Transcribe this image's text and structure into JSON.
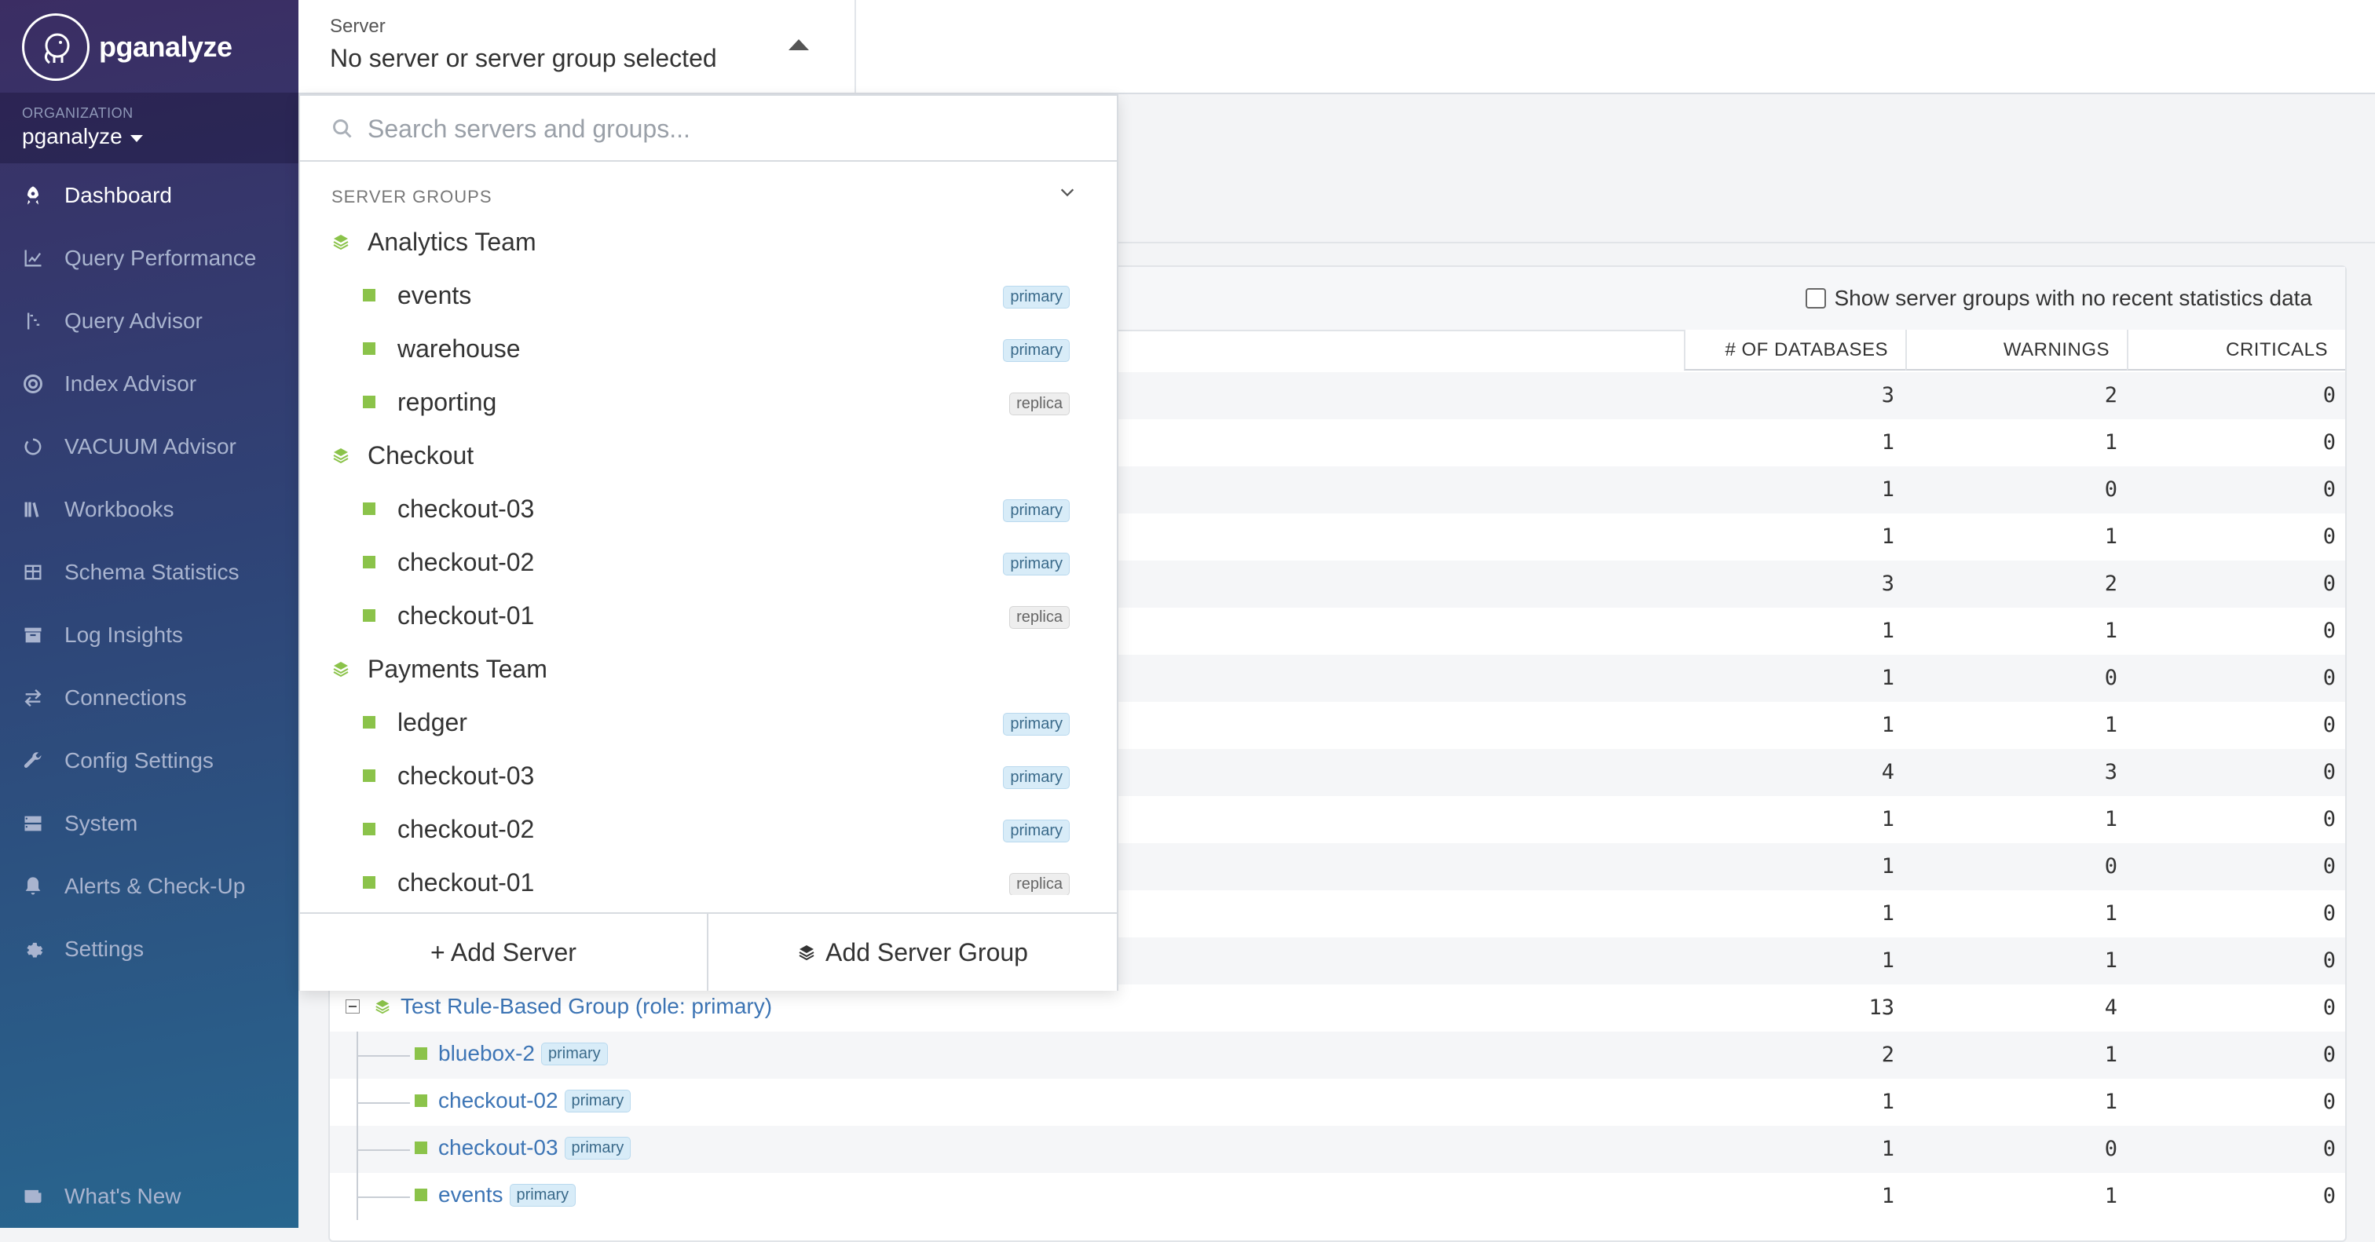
{
  "app": {
    "name": "pganalyze"
  },
  "organization": {
    "label": "ORGANIZATION",
    "value": "pganalyze"
  },
  "nav": [
    {
      "label": "Dashboard",
      "icon": "rocket-icon",
      "active": true
    },
    {
      "label": "Query Performance",
      "icon": "line-chart-icon"
    },
    {
      "label": "Query Advisor",
      "icon": "advisor-icon"
    },
    {
      "label": "Index Advisor",
      "icon": "target-icon"
    },
    {
      "label": "VACUUM Advisor",
      "icon": "circle-notch-icon"
    },
    {
      "label": "Workbooks",
      "icon": "books-icon"
    },
    {
      "label": "Schema Statistics",
      "icon": "table-icon"
    },
    {
      "label": "Log Insights",
      "icon": "archive-icon"
    },
    {
      "label": "Connections",
      "icon": "exchange-icon"
    },
    {
      "label": "Config Settings",
      "icon": "wrench-icon"
    },
    {
      "label": "System",
      "icon": "server-icon"
    },
    {
      "label": "Alerts & Check-Up",
      "icon": "bell-icon"
    },
    {
      "label": "Settings",
      "icon": "gear-icon"
    }
  ],
  "whats_new": {
    "label": "What's New",
    "icon": "newspaper-icon"
  },
  "server_select": {
    "label": "Server",
    "value": "No server or server group selected"
  },
  "dropdown": {
    "search_placeholder": "Search servers and groups...",
    "groups_header": "SERVER GROUPS",
    "groups": [
      {
        "name": "Analytics Team",
        "servers": [
          {
            "name": "events",
            "role": "primary"
          },
          {
            "name": "warehouse",
            "role": "primary"
          },
          {
            "name": "reporting",
            "role": "replica"
          }
        ]
      },
      {
        "name": "Checkout",
        "servers": [
          {
            "name": "checkout-03",
            "role": "primary"
          },
          {
            "name": "checkout-02",
            "role": "primary"
          },
          {
            "name": "checkout-01",
            "role": "replica"
          }
        ]
      },
      {
        "name": "Payments Team",
        "servers": [
          {
            "name": "ledger",
            "role": "primary"
          },
          {
            "name": "checkout-03",
            "role": "primary"
          },
          {
            "name": "checkout-02",
            "role": "primary"
          },
          {
            "name": "checkout-01",
            "role": "replica"
          }
        ]
      }
    ],
    "add_server": "+ Add Server",
    "add_group": "Add Server Group"
  },
  "table": {
    "show_no_data_label": "Show server groups with no recent statistics data",
    "columns": [
      "# OF DATABASES",
      "WARNINGS",
      "CRITICALS"
    ],
    "hidden_rows": [
      [
        3,
        2,
        0
      ],
      [
        1,
        1,
        0
      ],
      [
        1,
        0,
        0
      ],
      [
        1,
        1,
        0
      ],
      [
        3,
        2,
        0
      ],
      [
        1,
        1,
        0
      ],
      [
        1,
        0,
        0
      ],
      [
        1,
        1,
        0
      ],
      [
        4,
        3,
        0
      ],
      [
        1,
        1,
        0
      ],
      [
        1,
        0,
        0
      ],
      [
        1,
        1,
        0
      ],
      [
        1,
        1,
        0
      ]
    ],
    "group_row": {
      "name": "Test Rule-Based Group (role: primary)",
      "values": [
        13,
        4,
        0
      ]
    },
    "child_rows": [
      {
        "name": "bluebox-2",
        "role": "primary",
        "values": [
          2,
          1,
          0
        ]
      },
      {
        "name": "checkout-02",
        "role": "primary",
        "values": [
          1,
          1,
          0
        ]
      },
      {
        "name": "checkout-03",
        "role": "primary",
        "values": [
          1,
          0,
          0
        ]
      },
      {
        "name": "events",
        "role": "primary",
        "values": [
          1,
          1,
          0
        ]
      }
    ]
  }
}
